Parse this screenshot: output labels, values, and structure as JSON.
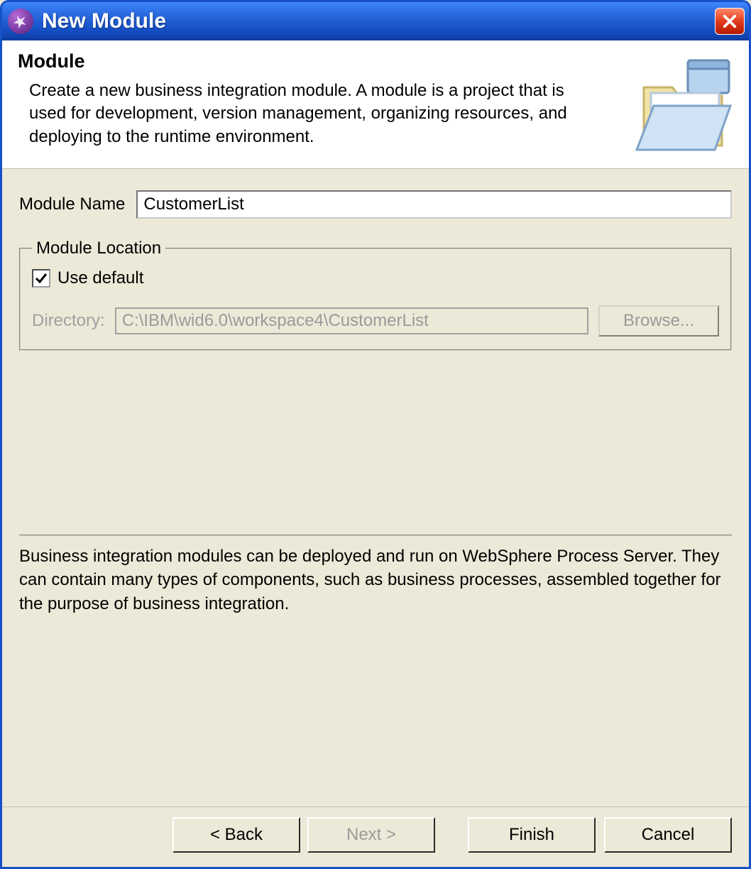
{
  "window": {
    "title": "New Module"
  },
  "banner": {
    "heading": "Module",
    "description": "Create a new business integration module. A module is a project that is used for development, version management, organizing resources, and deploying to the runtime environment."
  },
  "form": {
    "module_name_label": "Module Name",
    "module_name_value": "CustomerList",
    "location_legend": "Module Location",
    "use_default_label": "Use default",
    "use_default_checked": true,
    "directory_label": "Directory:",
    "directory_value": "C:\\IBM\\wid6.0\\workspace4\\CustomerList",
    "browse_label": "Browse..."
  },
  "footnote": "Business integration modules can be deployed and run on WebSphere Process Server. They can contain many types of components, such as business processes, assembled together for the purpose of business integration.",
  "buttons": {
    "back": "< Back",
    "next": "Next >",
    "finish": "Finish",
    "cancel": "Cancel",
    "next_enabled": false,
    "back_enabled": true
  }
}
